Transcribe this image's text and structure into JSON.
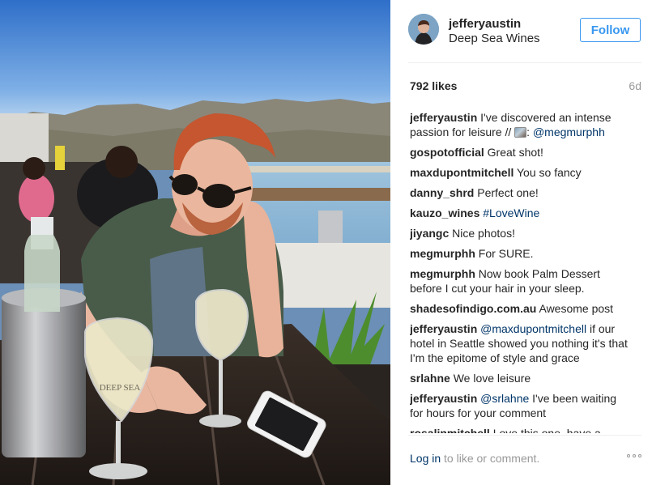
{
  "post": {
    "username": "jefferyaustin",
    "location": "Deep Sea Wines",
    "follow_label": "Follow",
    "likes": "792 likes",
    "time_ago": "6d",
    "photo_label": "DEEP SEA"
  },
  "caption": {
    "user": "jefferyaustin",
    "text": "I've discovered an intense passion for leisure // ",
    "emoji": "photo-emoji",
    "after_emoji": ": ",
    "mention": "@megmurphh"
  },
  "comments": [
    {
      "user": "gospotofficial",
      "mention": "",
      "text": "Great shot!"
    },
    {
      "user": "maxdupontmitchell",
      "mention": "",
      "text": "You so fancy"
    },
    {
      "user": "danny_shrd",
      "mention": "",
      "text": "Perfect one!"
    },
    {
      "user": "kauzo_wines",
      "mention": "#LoveWine",
      "text": ""
    },
    {
      "user": "jiyangc",
      "mention": "",
      "text": "Nice photos!"
    },
    {
      "user": "megmurphh",
      "mention": "",
      "text": "For SURE."
    },
    {
      "user": "megmurphh",
      "mention": "",
      "text": "Now book Palm Dessert before I cut your hair in your sleep."
    },
    {
      "user": "shadesofindigo.com.au",
      "mention": "",
      "text": "Awesome post"
    },
    {
      "user": "jefferyaustin",
      "mention": "@maxdupontmitchell",
      "text": "if our hotel in Seattle showed you nothing it's that I'm the epitome of style and grace"
    },
    {
      "user": "srlahne",
      "mention": "",
      "text": "We love leisure"
    },
    {
      "user": "jefferyaustin",
      "mention": "@srlahne",
      "text": "I've been waiting for hours for your comment"
    },
    {
      "user": "rosalinmitchell",
      "mention": "",
      "text": "Love this one, have a lovely day"
    }
  ],
  "footer": {
    "login_link": "Log in",
    "login_rest": " to like or comment.",
    "more_icon": "ellipsis-icon"
  },
  "colors": {
    "link": "#003569",
    "follow": "#3897f0",
    "muted": "#999999",
    "text": "#262626"
  }
}
